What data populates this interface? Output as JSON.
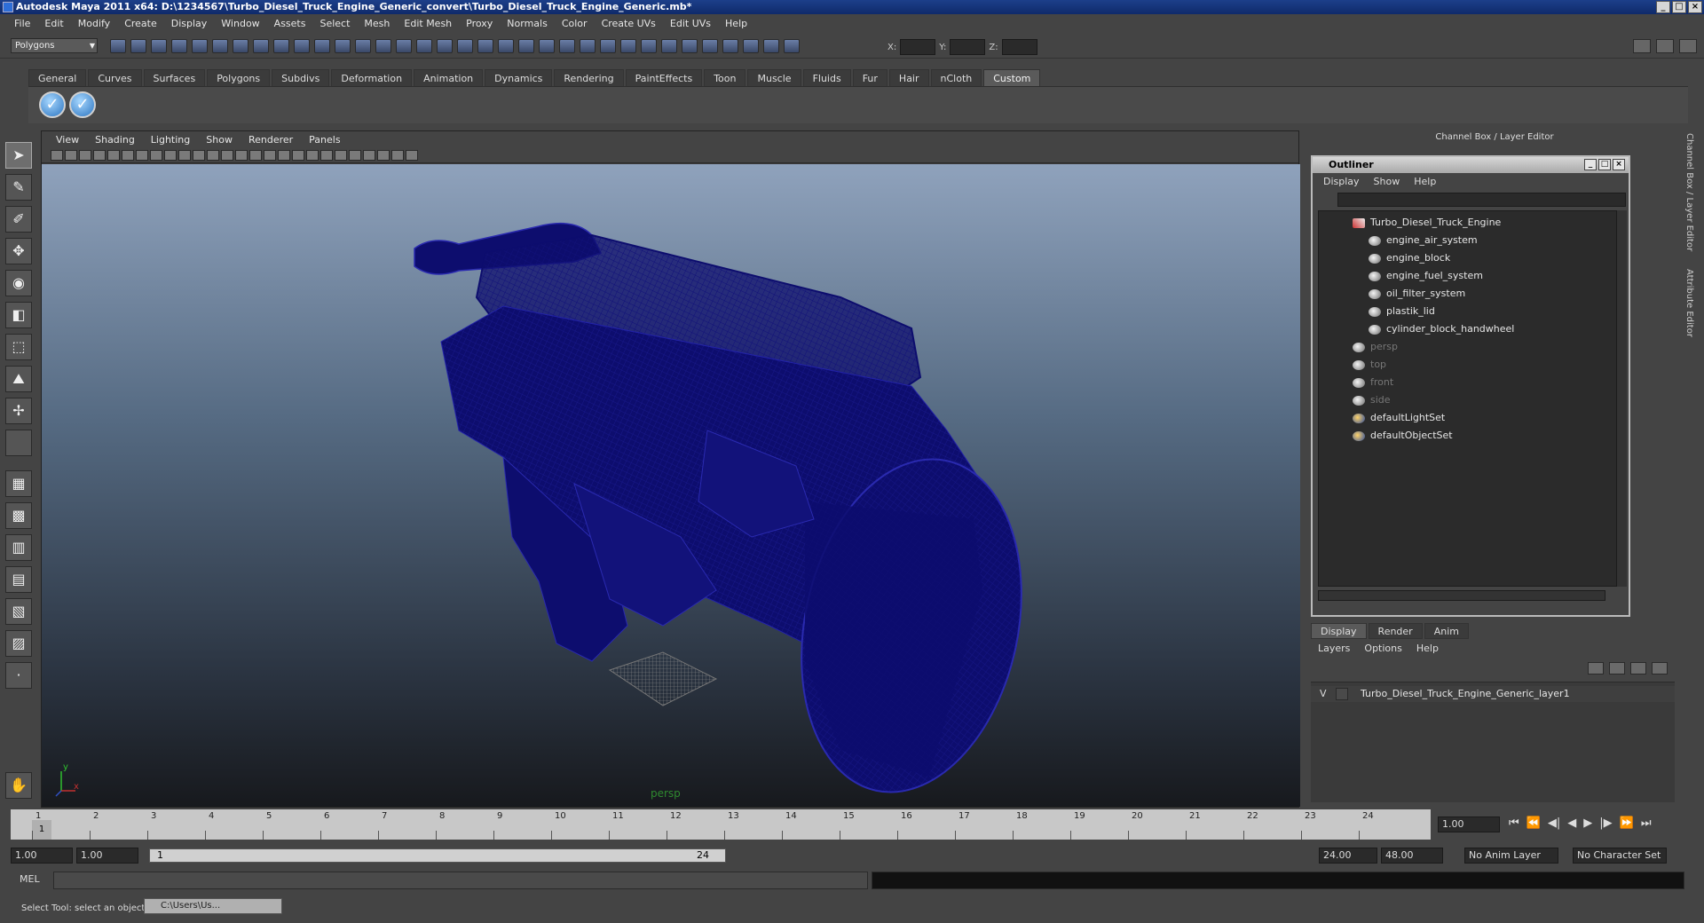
{
  "window": {
    "title": "Autodesk Maya 2011 x64: D:\\1234567\\Turbo_Diesel_Truck_Engine_Generic_convert\\Turbo_Diesel_Truck_Engine_Generic.mb*"
  },
  "menus": [
    "File",
    "Edit",
    "Modify",
    "Create",
    "Display",
    "Window",
    "Assets",
    "Select",
    "Mesh",
    "Edit Mesh",
    "Proxy",
    "Normals",
    "Color",
    "Create UVs",
    "Edit UVs",
    "Help"
  ],
  "toolbar": {
    "mode": "Polygons",
    "x_label": "X:",
    "y_label": "Y:",
    "z_label": "Z:"
  },
  "shelf_tabs": [
    "General",
    "Curves",
    "Surfaces",
    "Polygons",
    "Subdivs",
    "Deformation",
    "Animation",
    "Dynamics",
    "Rendering",
    "PaintEffects",
    "Toon",
    "Muscle",
    "Fluids",
    "Fur",
    "Hair",
    "nCloth",
    "Custom"
  ],
  "shelf_active": "Custom",
  "viewport": {
    "menus": [
      "View",
      "Shading",
      "Lighting",
      "Show",
      "Renderer",
      "Panels"
    ],
    "camera_label": "persp",
    "axis_y": "y",
    "axis_x": "x"
  },
  "right_panel": {
    "title": "Channel Box / Layer Editor"
  },
  "outliner": {
    "title": "Outliner",
    "menus": [
      "Display",
      "Show",
      "Help"
    ],
    "items": [
      {
        "label": "Turbo_Diesel_Truck_Engine",
        "indent": 0,
        "kind": "root",
        "dim": false
      },
      {
        "label": "engine_air_system",
        "indent": 1,
        "kind": "mesh",
        "dim": false
      },
      {
        "label": "engine_block",
        "indent": 1,
        "kind": "mesh",
        "dim": false
      },
      {
        "label": "engine_fuel_system",
        "indent": 1,
        "kind": "mesh",
        "dim": false
      },
      {
        "label": "oil_filter_system",
        "indent": 1,
        "kind": "mesh",
        "dim": false
      },
      {
        "label": "plastik_lid",
        "indent": 1,
        "kind": "mesh",
        "dim": false
      },
      {
        "label": "cylinder_block_handwheel",
        "indent": 1,
        "kind": "mesh",
        "dim": false
      },
      {
        "label": "persp",
        "indent": 0,
        "kind": "camera",
        "dim": true
      },
      {
        "label": "top",
        "indent": 0,
        "kind": "camera",
        "dim": true
      },
      {
        "label": "front",
        "indent": 0,
        "kind": "camera",
        "dim": true
      },
      {
        "label": "side",
        "indent": 0,
        "kind": "camera",
        "dim": true
      },
      {
        "label": "defaultLightSet",
        "indent": 0,
        "kind": "set",
        "dim": false
      },
      {
        "label": "defaultObjectSet",
        "indent": 0,
        "kind": "set",
        "dim": false
      }
    ]
  },
  "layer_editor": {
    "tabs": [
      "Display",
      "Render",
      "Anim"
    ],
    "active_tab": "Display",
    "menus": [
      "Layers",
      "Options",
      "Help"
    ],
    "layer": {
      "visible": "V",
      "name": "Turbo_Diesel_Truck_Engine_Generic_layer1"
    }
  },
  "side_tabs": [
    "Channel Box / Layer Editor",
    "Attribute Editor"
  ],
  "timeline": {
    "ticks": [
      "1",
      "2",
      "3",
      "4",
      "5",
      "6",
      "7",
      "8",
      "9",
      "10",
      "11",
      "12",
      "13",
      "14",
      "15",
      "16",
      "17",
      "18",
      "19",
      "20",
      "21",
      "22",
      "23",
      "24"
    ],
    "current_frame": "1",
    "current_time": "1.00"
  },
  "range": {
    "start": "1.00",
    "playback_start": "1.00",
    "slider_start": "1",
    "slider_end": "24",
    "playback_end": "24.00",
    "end": "48.00",
    "anim_layer": "No Anim Layer",
    "character_set": "No Character Set"
  },
  "command": {
    "mel_label": "MEL"
  },
  "status": {
    "help_line": "Select Tool: select an object",
    "task_item": "C:\\Users\\Us..."
  },
  "colors": {
    "wireframe": "#0d0d6e",
    "bg_top": "#8fa2bc",
    "bg_bottom": "#17191d"
  }
}
